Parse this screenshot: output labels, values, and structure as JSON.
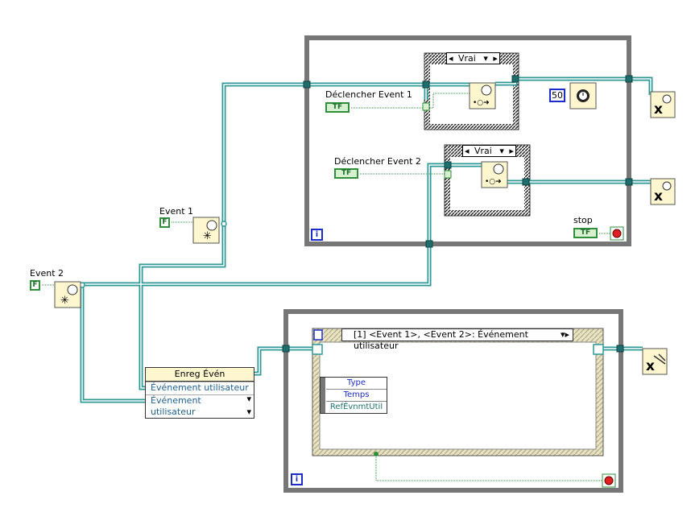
{
  "labels": {
    "trigger1": "Déclencher Event 1",
    "trigger2": "Déclencher Event 2",
    "event1": "Event 1",
    "event2": "Event 2",
    "stop": "stop"
  },
  "case1_selector": "Vrai",
  "case2_selector": "Vrai",
  "wait_constant": "50",
  "loop_index": "i",
  "bool_false": "F",
  "bool_tf": "TF",
  "register_node": {
    "title": "Enreg Évén",
    "inputs": [
      "Événement utilisateur",
      "Événement utilisateur"
    ]
  },
  "event_structure": {
    "selector": "[1] <Event 1>, <Event 2>: Événement utilisateur",
    "data_items": [
      "Type",
      "Temps",
      "RefÉvnmtUtil"
    ]
  },
  "colors": {
    "wire": "#2f9a95",
    "bool_wire": "#2f8f3a",
    "loop_frame": "#777777",
    "numeric_blue": "#1a2cc9",
    "node_fill": "#fdf6cf"
  }
}
